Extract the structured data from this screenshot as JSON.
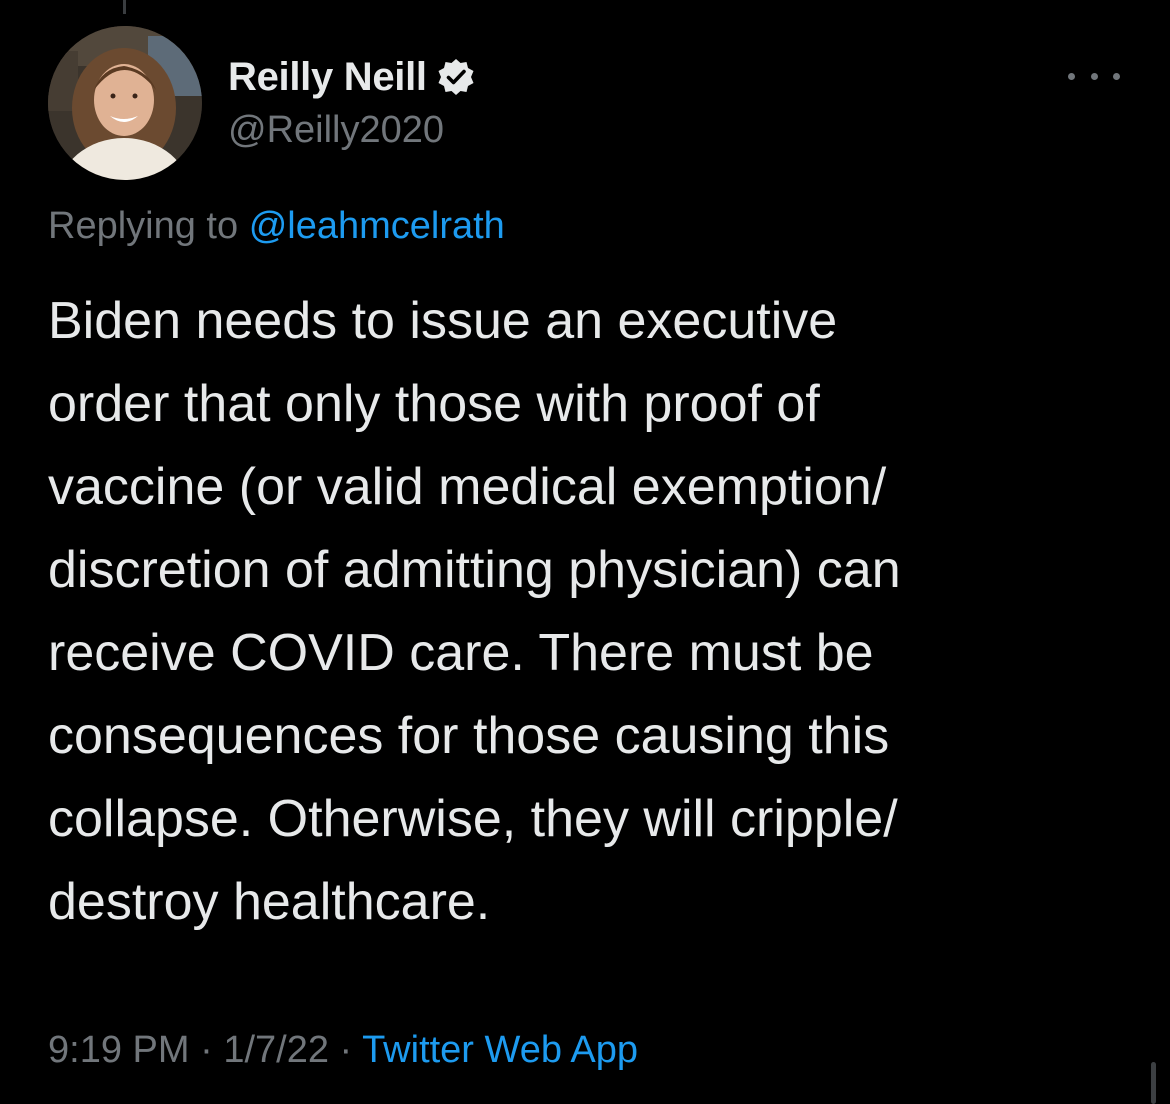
{
  "colors": {
    "background": "#000000",
    "primary_text": "#e7e9ea",
    "secondary_text": "#71767b",
    "link": "#1d9bf0",
    "verified_badge": "#e7e9ea"
  },
  "author": {
    "display_name": "Reilly Neill",
    "handle": "@Reilly2020",
    "verified": true,
    "avatar_icon": "profile-photo"
  },
  "menu": {
    "icon": "more-horizontal-icon"
  },
  "reply": {
    "prefix": "Replying to",
    "mention": "@leahmcelrath"
  },
  "tweet": {
    "lines": [
      "Biden needs to issue an executive",
      "order that only those with proof of",
      "vaccine (or valid medical exemption/",
      "discretion of admitting physician) can",
      "receive COVID care. There must be",
      "consequences for those causing this",
      "collapse. Otherwise, they will cripple/",
      "destroy healthcare."
    ]
  },
  "meta": {
    "time": "9:19 PM",
    "separator": "·",
    "date": "1/7/22",
    "source": "Twitter Web App"
  }
}
